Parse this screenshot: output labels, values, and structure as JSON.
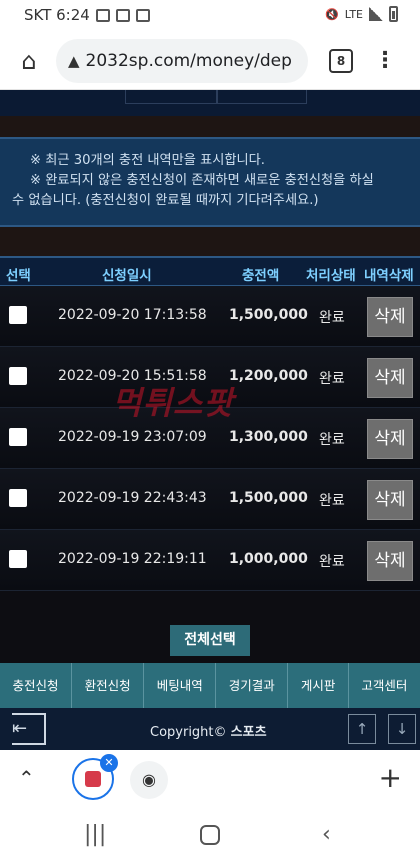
{
  "status_bar": {
    "carrier_time": "SKT 6:24",
    "network": "LTE"
  },
  "browser": {
    "url": "2032sp.com/money/dep",
    "tab_count": "8"
  },
  "notice": {
    "line1": "※ 최근 30개의 충전 내역만을 표시합니다.",
    "line2": "※ 완료되지 않은 충전신청이 존재하면 새로운 충전신청을 하실",
    "line3": "수 없습니다. (충전신청이 완료될 때까지 기다려주세요.)"
  },
  "table": {
    "headers": {
      "select": "선택",
      "date": "신청일시",
      "amount": "충전액",
      "status": "처리상태",
      "delete": "내역삭제"
    },
    "rows": [
      {
        "date": "2022-09-20 17:13:58",
        "amount": "1,500,000",
        "status": "완료",
        "delete": "삭제"
      },
      {
        "date": "2022-09-20 15:51:58",
        "amount": "1,200,000",
        "status": "완료",
        "delete": "삭제"
      },
      {
        "date": "2022-09-19 23:07:09",
        "amount": "1,300,000",
        "status": "완료",
        "delete": "삭제"
      },
      {
        "date": "2022-09-19 22:43:43",
        "amount": "1,500,000",
        "status": "완료",
        "delete": "삭제"
      },
      {
        "date": "2022-09-19 22:19:11",
        "amount": "1,000,000",
        "status": "완료",
        "delete": "삭제"
      }
    ]
  },
  "watermark": "먹튀스팟",
  "select_all": "전체선택",
  "nav": [
    "충전신청",
    "환전신청",
    "베팅내역",
    "경기결과",
    "게시판",
    "고객센터"
  ],
  "footer": {
    "copyright_prefix": "Copyright©",
    "copyright_brand": "스포츠"
  },
  "icons": {
    "home": "home-icon",
    "warning": "warning-icon",
    "menu": "more-vert-icon",
    "logout": "logout-icon",
    "scroll_up": "arrow-up-icon",
    "scroll_down": "arrow-down-icon"
  },
  "colors": {
    "notice_bg": "#14375b",
    "header_text": "#7ed0ff",
    "nav_bg": "#2c6e7b",
    "delete_button": "#6e6e6e"
  }
}
